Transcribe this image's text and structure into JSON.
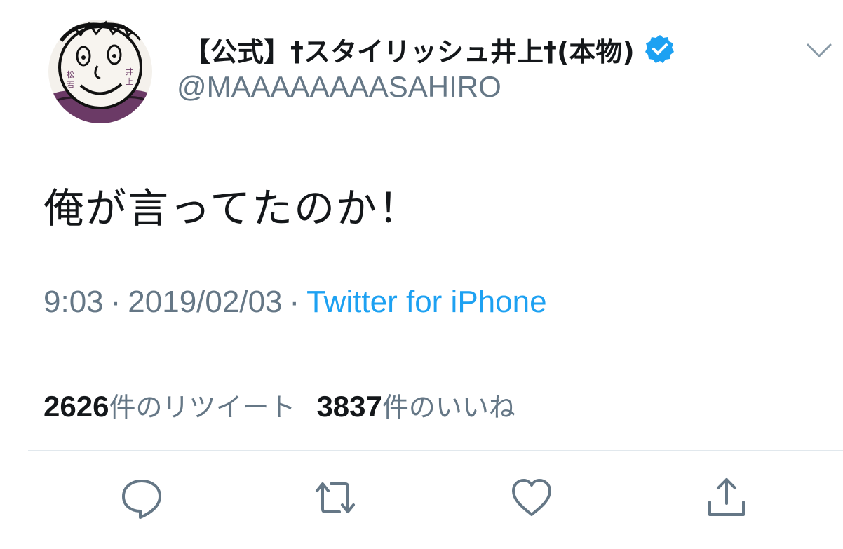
{
  "author": {
    "display_name": "【公式】†スタイリッシュ井上†(本物)",
    "handle": "@MAAAAAAAASAHIRO",
    "verified": true,
    "avatar": "caricature-face-avatar"
  },
  "tweet": {
    "text": "俺が言ってたのか！",
    "time": "9:03",
    "date": "2019/02/03",
    "separator": "·",
    "source": "Twitter for iPhone"
  },
  "stats": {
    "retweets_count": "2626",
    "retweets_label": "件のリツイート",
    "likes_count": "3837",
    "likes_label": "件のいいね"
  },
  "actions": {
    "reply_icon": "reply-icon",
    "retweet_icon": "retweet-icon",
    "like_icon": "heart-icon",
    "share_icon": "share-icon"
  },
  "colors": {
    "text": "#14171a",
    "secondary": "#657786",
    "link": "#1da1f2",
    "verified": "#1da1f2",
    "divider": "#e1e8ed"
  }
}
